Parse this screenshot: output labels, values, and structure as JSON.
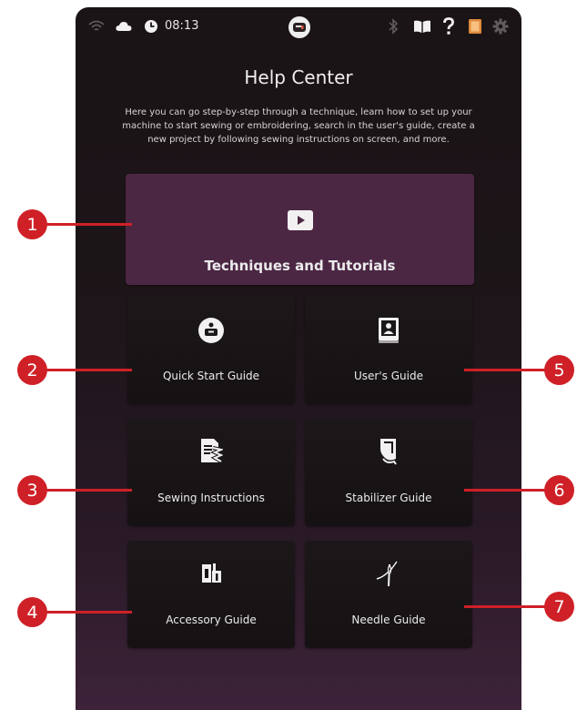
{
  "status_bar": {
    "time": "08:13",
    "icons": [
      "wifi-icon",
      "cloud-icon",
      "clock-icon",
      "machine-icon",
      "bluetooth-icon",
      "book-icon",
      "help-icon",
      "embroidery-icon",
      "settings-icon"
    ]
  },
  "header": {
    "title": "Help Center",
    "description": "Here you can go step-by-step through a technique, learn how to set up your machine to start sewing or embroidering, search in the user's guide, create a new project by following sewing instructions on screen, and more."
  },
  "tiles": [
    {
      "label": "Techniques and Tutorials",
      "icon": "play-icon",
      "callout": "1"
    },
    {
      "label": "Quick Start Guide",
      "icon": "sewing-machine-icon",
      "callout": "2"
    },
    {
      "label": "Sewing Instructions",
      "icon": "sewing-instructions-icon",
      "callout": "3"
    },
    {
      "label": "Accessory Guide",
      "icon": "accessory-icon",
      "callout": "4"
    },
    {
      "label": "User's Guide",
      "icon": "users-guide-book-icon",
      "callout": "5"
    },
    {
      "label": "Stabilizer Guide",
      "icon": "stabilizer-icon",
      "callout": "6"
    },
    {
      "label": "Needle Guide",
      "icon": "needle-icon",
      "callout": "7"
    }
  ],
  "colors": {
    "accent_tile": "#4c2744",
    "callout": "#cf2027",
    "background_top": "#1a1416",
    "background_bottom": "#3d2339"
  }
}
